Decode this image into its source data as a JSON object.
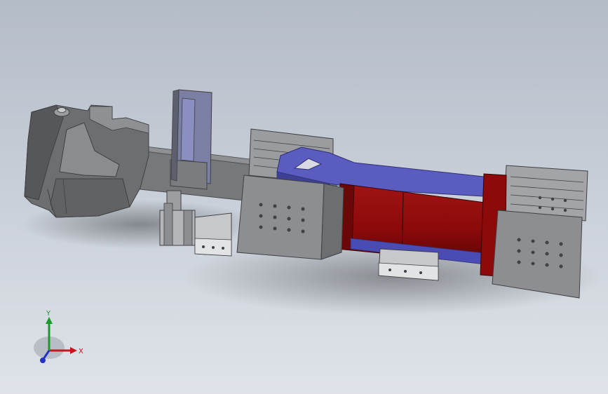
{
  "viewport": {
    "background_top": "#b4bcc8",
    "background_bottom": "#dfe3e9"
  },
  "model": {
    "part_colors": {
      "gray_body": "#707274",
      "gray_light": "#8e9093",
      "blue_arm": "#5a5dbf",
      "blue_dark": "#3e4192",
      "red_cylinder": "#8c0a0a",
      "red_dark": "#5a0505"
    }
  },
  "triad": {
    "x_label": "X",
    "y_label": "Y",
    "x_color": "#c4161c",
    "y_color": "#1a9a2a",
    "z_color": "#2233c4"
  }
}
